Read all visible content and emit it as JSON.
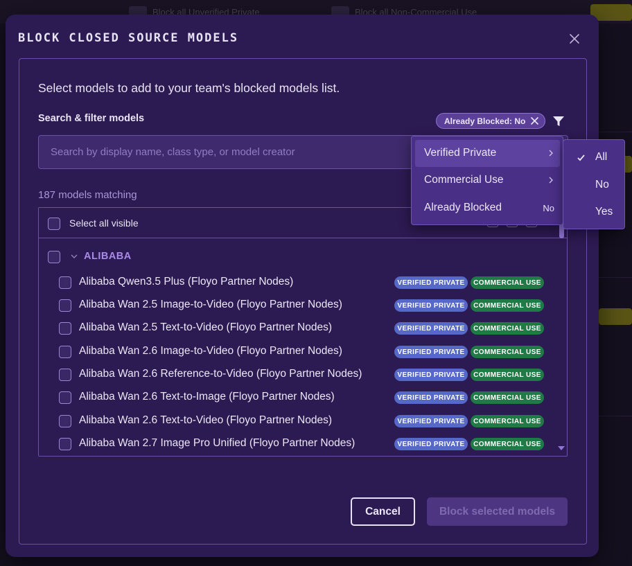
{
  "background": {
    "tabs": [
      "Block all Unverified Private",
      "Block all Non-Commercial Use"
    ]
  },
  "modal": {
    "title": "BLOCK CLOSED SOURCE MODELS",
    "intro": "Select models to add to your team's blocked models list.",
    "search_label": "Search & filter models",
    "filter_chip": "Already Blocked: No",
    "search_placeholder": "Search by display name, class type, or model creator",
    "search_value": "",
    "match_count": "187 models matching",
    "select_all_label": "Select all visible",
    "group": "ALIBABA",
    "badges": {
      "verified": "VERIFIED PRIVATE",
      "commercial": "COMMERCIAL USE"
    },
    "models": [
      "Alibaba Qwen3.5 Plus (Floyo Partner Nodes)",
      "Alibaba Wan 2.5 Image-to-Video (Floyo Partner Nodes)",
      "Alibaba Wan 2.5 Text-to-Video (Floyo Partner Nodes)",
      "Alibaba Wan 2.6 Image-to-Video (Floyo Partner Nodes)",
      "Alibaba Wan 2.6 Reference-to-Video (Floyo Partner Nodes)",
      "Alibaba Wan 2.6 Text-to-Image (Floyo Partner Nodes)",
      "Alibaba Wan 2.6 Text-to-Video (Floyo Partner Nodes)",
      "Alibaba Wan 2.7 Image Pro Unified (Floyo Partner Nodes)"
    ],
    "cancel_label": "Cancel",
    "block_label": "Block selected models"
  },
  "filter_menu": {
    "items": [
      {
        "label": "Verified Private",
        "value": ""
      },
      {
        "label": "Commercial Use",
        "value": ""
      },
      {
        "label": "Already Blocked",
        "value": "No"
      }
    ],
    "submenu": [
      "All",
      "No",
      "Yes"
    ],
    "submenu_selected": "All"
  },
  "colors": {
    "modal_bg": "#2c1a52",
    "accent": "#a98ae6",
    "verified_badge": "#5668c8",
    "commercial_badge": "#1f7a45"
  }
}
